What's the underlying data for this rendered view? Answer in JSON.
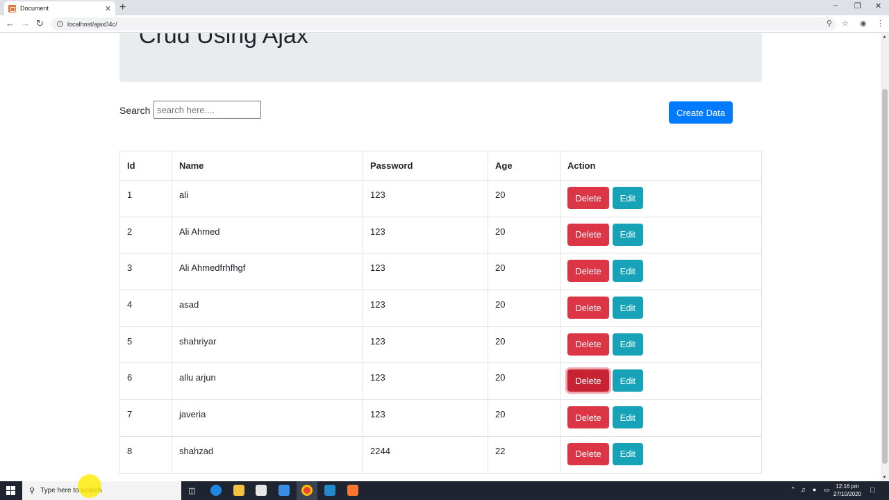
{
  "browser": {
    "tab_title": "Document",
    "url": "localhost/ajax04c/",
    "new_tab": "+",
    "close": "✕"
  },
  "page": {
    "heading": "Crud Using Ajax",
    "search_label": "Search :",
    "search_placeholder": "search here....",
    "create_button": "Create Data"
  },
  "table": {
    "headers": [
      "Id",
      "Name",
      "Password",
      "Age",
      "Action"
    ],
    "rows": [
      {
        "id": "1",
        "name": "ali",
        "password": "123",
        "age": "20"
      },
      {
        "id": "2",
        "name": "Ali Ahmed",
        "password": "123",
        "age": "20"
      },
      {
        "id": "3",
        "name": "Ali Ahmedfrhfhgf",
        "password": "123",
        "age": "20"
      },
      {
        "id": "4",
        "name": "asad",
        "password": "123",
        "age": "20"
      },
      {
        "id": "5",
        "name": "shahriyar",
        "password": "123",
        "age": "20"
      },
      {
        "id": "6",
        "name": "allu arjun",
        "password": "123",
        "age": "20"
      },
      {
        "id": "7",
        "name": "javeria",
        "password": "123",
        "age": "20"
      },
      {
        "id": "8",
        "name": "shahzad",
        "password": "2244",
        "age": "22"
      }
    ],
    "delete_label": "Delete",
    "edit_label": "Edit"
  },
  "taskbar": {
    "search_placeholder": "Type here to search",
    "time": "12:16 pm",
    "date": "27/10/2020"
  },
  "colors": {
    "primary": "#007bff",
    "danger": "#dc3545",
    "info": "#17a2b8",
    "jumbotron": "#e9ecef"
  }
}
